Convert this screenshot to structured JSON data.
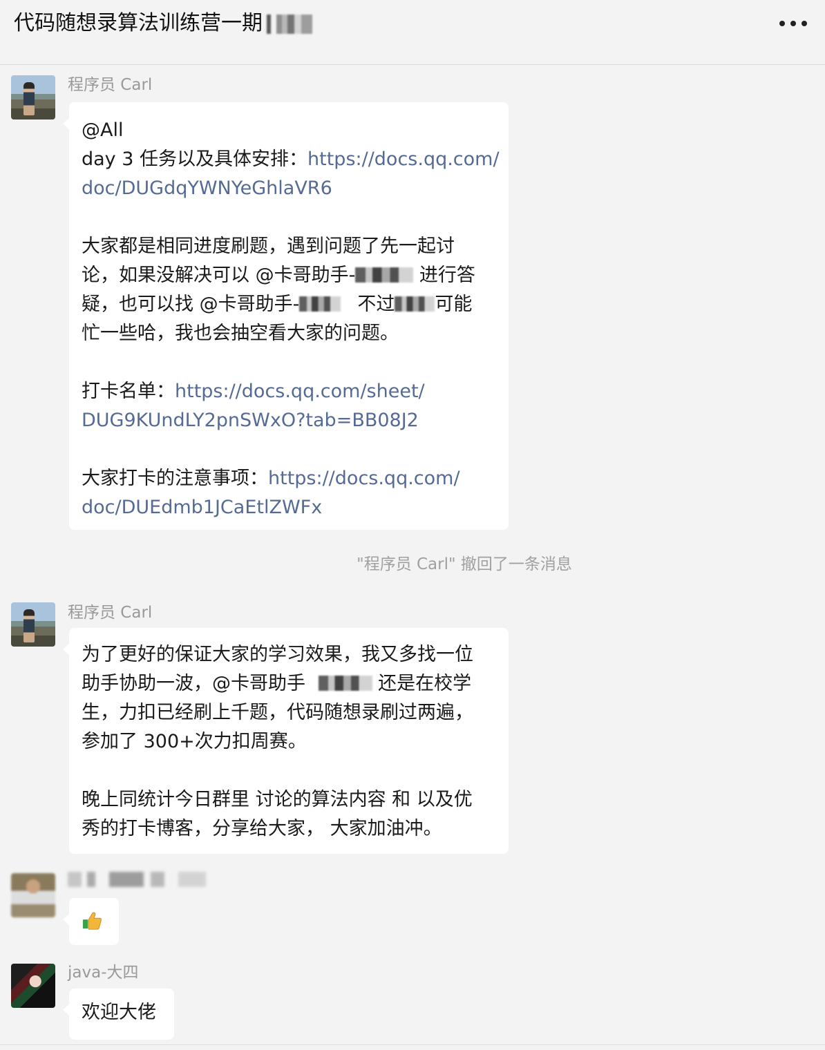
{
  "header": {
    "title": "代码随想录算法训练营一期",
    "more_icon": "more-horizontal-icon"
  },
  "messages": [
    {
      "sender": "程序员 Carl",
      "lines": {
        "l1": "@All",
        "l2_text": "day 3 任务以及具体安排：",
        "l2_link": "https://docs.qq.com/",
        "l3_link": "doc/DUGdqYWNYeGhlaVR6",
        "l5": "大家都是相同进度刷题，遇到问题了先一起讨",
        "l6a": "论，如果没解决可以 @卡哥助手-",
        "l6b": " 进行答",
        "l7a": "疑，也可以找 @卡哥助手-",
        "l7b": "不过",
        "l7c": "可能",
        "l8": "忙一些哈，我也会抽空看大家的问题。",
        "l10_text": "打卡名单：",
        "l10_link": "https://docs.qq.com/sheet/",
        "l11_link": "DUG9KUndLY2pnSWxO?tab=BB08J2",
        "l13_text": "大家打卡的注意事项：",
        "l13_link": "https://docs.qq.com/",
        "l14_link": "doc/DUEdmb1JCaEtlZWFx"
      }
    },
    {
      "system": "\"程序员 Carl\" 撤回了一条消息"
    },
    {
      "sender": "程序员 Carl",
      "lines": {
        "l1": "为了更好的保证大家的学习效果，我又多找一位",
        "l2a": "助手协助一波，@卡哥助手 ",
        "l2b": " 还是在校学",
        "l3": "生，力扣已经刷上千题，代码随想录刷过两遍，",
        "l4": "参加了 300+次力扣周赛。",
        "l6": "晚上同统计今日群里 讨论的算法内容 和 以及优",
        "l7": "秀的打卡博客，分享给大家， 大家加油冲。"
      }
    },
    {
      "sender": "",
      "emoji": "thumbs-up-icon"
    },
    {
      "sender": "java-大四",
      "text": "欢迎大佬"
    }
  ]
}
